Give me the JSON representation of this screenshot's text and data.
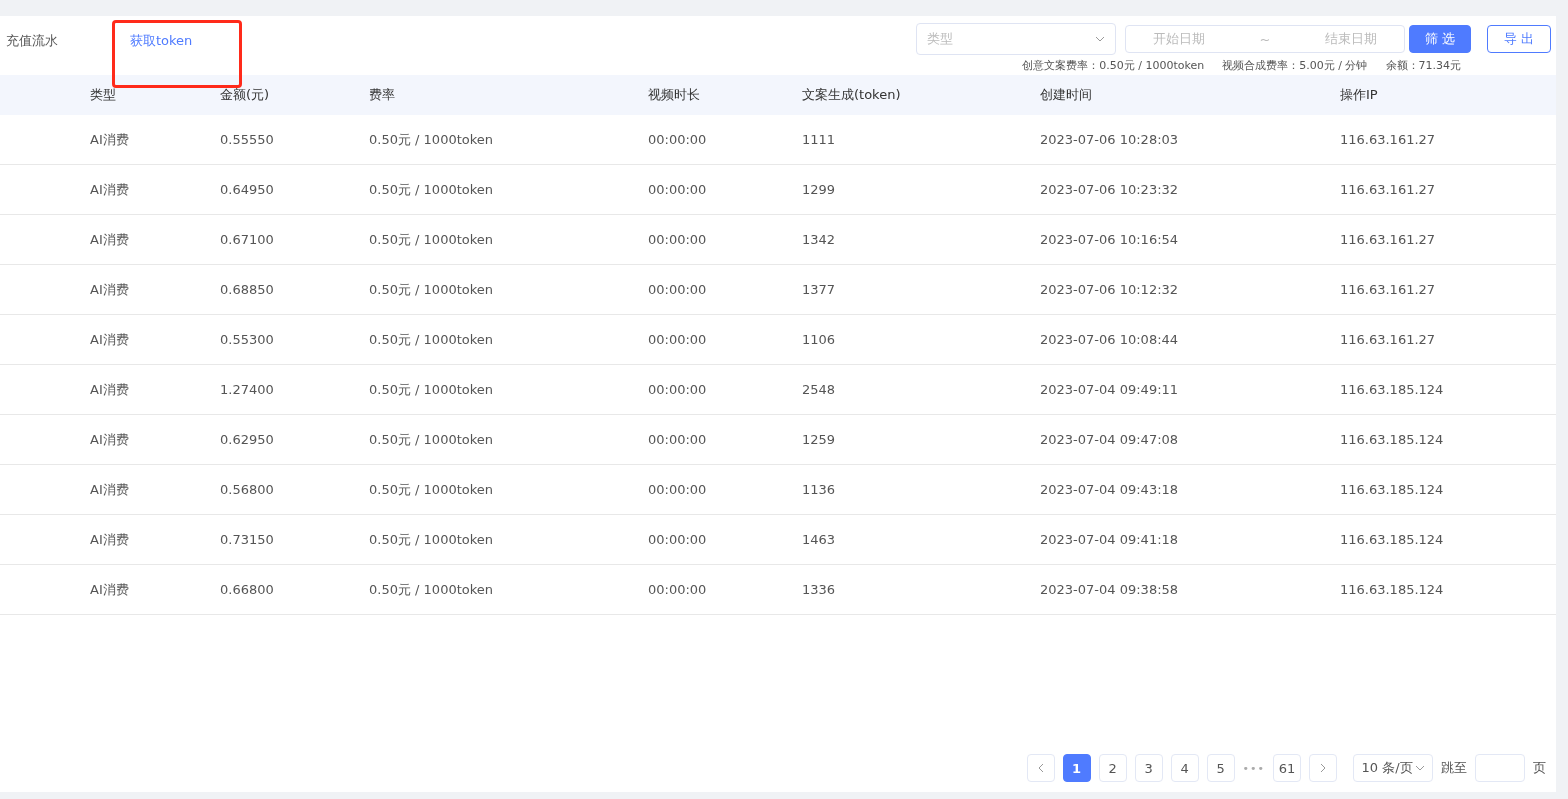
{
  "header": {
    "tabs": [
      {
        "label": "充值流水",
        "selected": false
      },
      {
        "label": "获取token",
        "selected": true
      }
    ],
    "type_select": {
      "placeholder": "类型"
    },
    "date_range": {
      "start_placeholder": "开始日期",
      "separator": "~",
      "end_placeholder": "结束日期"
    },
    "buttons": [
      {
        "label": "筛 选",
        "kind": "primary"
      },
      {
        "label": "导 出",
        "kind": "outline"
      }
    ],
    "info": [
      "创意文案费率：0.50元 / 1000token",
      "视频合成费率：5.00元 / 分钟",
      "余额：71.34元"
    ]
  },
  "table": {
    "columns": [
      "类型",
      "金额(元)",
      "费率",
      "视频时长",
      "文案生成(token)",
      "创建时间",
      "操作IP"
    ],
    "rows": [
      [
        "AI消费",
        "0.55550",
        "0.50元 / 1000token",
        "00:00:00",
        "1111",
        "2023-07-06 10:28:03",
        "116.63.161.27"
      ],
      [
        "AI消费",
        "0.64950",
        "0.50元 / 1000token",
        "00:00:00",
        "1299",
        "2023-07-06 10:23:32",
        "116.63.161.27"
      ],
      [
        "AI消费",
        "0.67100",
        "0.50元 / 1000token",
        "00:00:00",
        "1342",
        "2023-07-06 10:16:54",
        "116.63.161.27"
      ],
      [
        "AI消费",
        "0.68850",
        "0.50元 / 1000token",
        "00:00:00",
        "1377",
        "2023-07-06 10:12:32",
        "116.63.161.27"
      ],
      [
        "AI消费",
        "0.55300",
        "0.50元 / 1000token",
        "00:00:00",
        "1106",
        "2023-07-06 10:08:44",
        "116.63.161.27"
      ],
      [
        "AI消费",
        "1.27400",
        "0.50元 / 1000token",
        "00:00:00",
        "2548",
        "2023-07-04 09:49:11",
        "116.63.185.124"
      ],
      [
        "AI消费",
        "0.62950",
        "0.50元 / 1000token",
        "00:00:00",
        "1259",
        "2023-07-04 09:47:08",
        "116.63.185.124"
      ],
      [
        "AI消费",
        "0.56800",
        "0.50元 / 1000token",
        "00:00:00",
        "1136",
        "2023-07-04 09:43:18",
        "116.63.185.124"
      ],
      [
        "AI消费",
        "0.73150",
        "0.50元 / 1000token",
        "00:00:00",
        "1463",
        "2023-07-04 09:41:18",
        "116.63.185.124"
      ],
      [
        "AI消费",
        "0.66800",
        "0.50元 / 1000token",
        "00:00:00",
        "1336",
        "2023-07-04 09:38:58",
        "116.63.185.124"
      ]
    ]
  },
  "pagination": {
    "pages": [
      {
        "label": "1",
        "selected": true
      },
      {
        "label": "2",
        "selected": false
      },
      {
        "label": "3",
        "selected": false
      },
      {
        "label": "4",
        "selected": false
      },
      {
        "label": "5",
        "selected": false
      },
      {
        "label": "•••",
        "kind": "ellipsis"
      },
      {
        "label": "61",
        "selected": false
      }
    ],
    "page_size": "10 条/页",
    "jump_label": "跳至",
    "page_unit": "页"
  }
}
